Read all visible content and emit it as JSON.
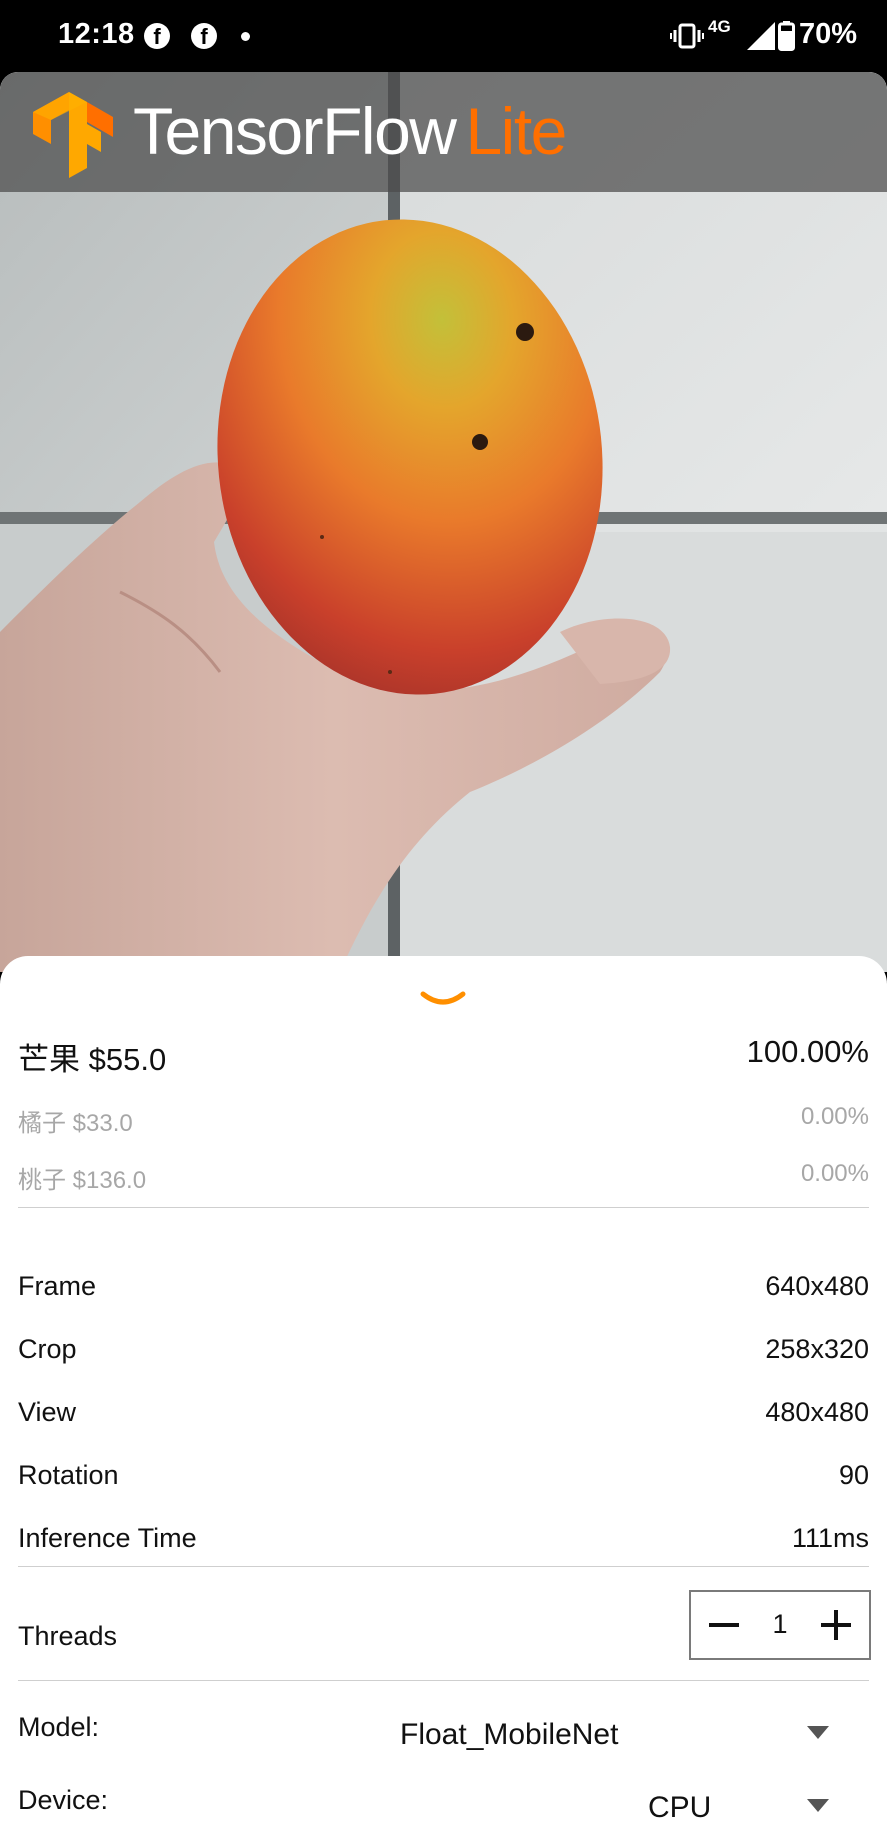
{
  "status_bar": {
    "time": "12:18",
    "facebook_icon_glyph": "f",
    "network": "4G",
    "battery": "70%"
  },
  "toolbar": {
    "brand_main": "TensorFlow",
    "brand_accent": "Lite",
    "accent_color": "#ff6f00"
  },
  "results": [
    {
      "label": "芒果 $55.0",
      "score": "100.00%"
    },
    {
      "label": "橘子 $33.0",
      "score": "0.00%"
    },
    {
      "label": "桃子 $136.0",
      "score": "0.00%"
    }
  ],
  "info": {
    "frame": {
      "label": "Frame",
      "value": "640x480"
    },
    "crop": {
      "label": "Crop",
      "value": "258x320"
    },
    "view": {
      "label": "View",
      "value": "480x480"
    },
    "rotation": {
      "label": "Rotation",
      "value": "90"
    },
    "inference": {
      "label": "Inference Time",
      "value": "111ms"
    }
  },
  "threads": {
    "label": "Threads",
    "value": "1"
  },
  "model": {
    "label": "Model:",
    "selected": "Float_MobileNet"
  },
  "device": {
    "label": "Device:",
    "selected": "CPU"
  },
  "icons": {
    "handle": "chevron-down-icon",
    "minus": "minus-icon",
    "plus": "plus-icon",
    "dropdown": "dropdown-arrow-icon"
  }
}
